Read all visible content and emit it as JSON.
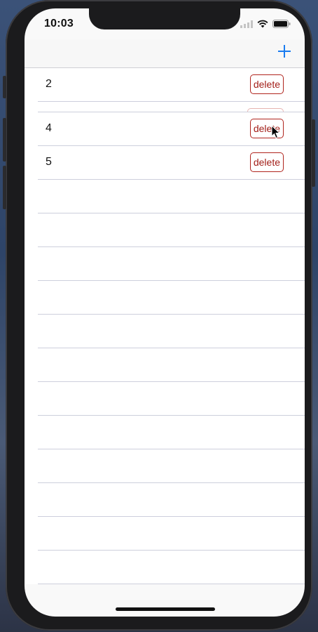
{
  "status_bar": {
    "time": "10:03",
    "icons": [
      "signal-icon",
      "wifi-icon",
      "battery-icon"
    ]
  },
  "nav_bar": {
    "add_icon": "plus-icon",
    "accent_color": "#1a7cf0"
  },
  "list": {
    "rows": [
      {
        "label": "2",
        "button": "delete"
      },
      {
        "label": "",
        "button": "delete",
        "state": "animating"
      },
      {
        "label": "4",
        "button": "delete"
      },
      {
        "label": "5",
        "button": "delete"
      }
    ],
    "empty_row_count": 12
  },
  "colors": {
    "delete": "#a3201a",
    "separator": "#cdcfdc"
  }
}
